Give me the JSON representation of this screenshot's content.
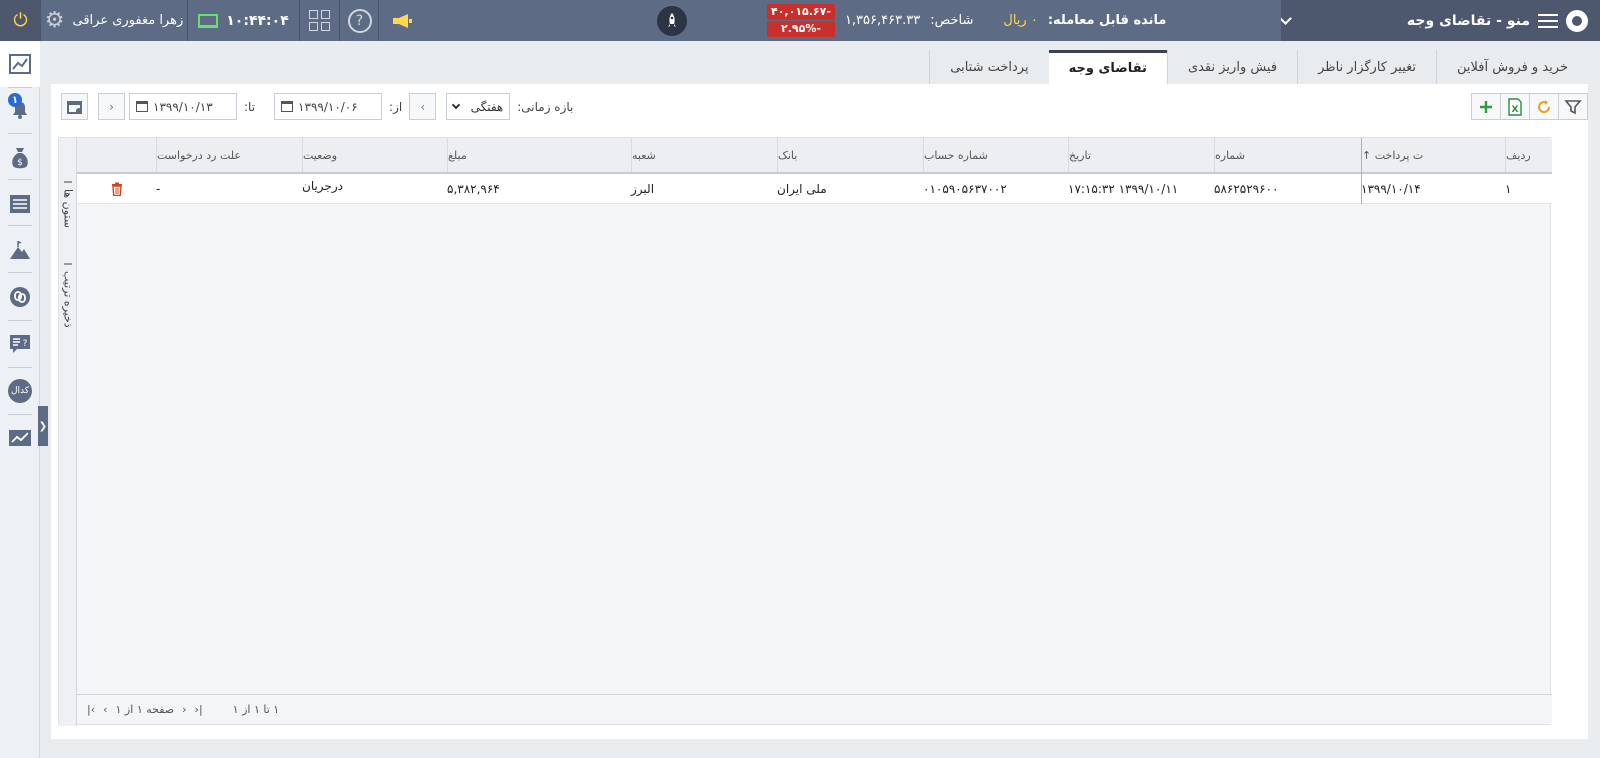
{
  "header": {
    "title": "منو - تقاضای وجه",
    "balance_label": "مانده قابل معامله:",
    "balance_value": "۰ ریال",
    "index_label": "شاخص:",
    "index_value": "۱,۳۵۶,۴۶۳.۳۳",
    "index_change": "-۴۰,۰۱۵.۶۷",
    "index_percent": "-۲.۹۵%",
    "clock": "۱۰:۴۴:۰۴",
    "user_name": "زهرا مغفوری عراقی",
    "help_glyph": "?"
  },
  "sidebar": {
    "notification_count": "۱",
    "coin_label": "کدال"
  },
  "tabs": [
    {
      "label": "پرداخت شتابی"
    },
    {
      "label": "تقاضای وجه"
    },
    {
      "label": "فیش واریز نقدی"
    },
    {
      "label": "تغییر کارگزار ناظر"
    },
    {
      "label": "خرید و فروش آفلاین"
    }
  ],
  "filters": {
    "range_label": "بازه زمانی:",
    "range_value": "هفتگی",
    "from_label": "از:",
    "from_date": "۱۳۹۹/۱۰/۰۶",
    "to_label": "تا:",
    "to_date": "۱۳۹۹/۱۰/۱۳"
  },
  "grid": {
    "columns": {
      "row": "ردیف",
      "pay_date": "ت پرداخت ↑",
      "number": "شماره",
      "date": "تاریخ",
      "account": "شماره حساب",
      "bank": "بانک",
      "branch": "شعبه",
      "amount": "مبلغ",
      "status": "وضعیت",
      "reject_reason": "علت رد درخواست"
    },
    "rows": [
      {
        "row": "۱",
        "pay_date": "۱۳۹۹/۱۰/۱۴",
        "number": "۵۸۶۲۵۲۹۶۰۰",
        "date": "۱۳۹۹/۱۰/۱۱ ۱۷:۱۵:۳۲",
        "account": "۰۱۰۵۹۰۵۶۳۷۰۰۲",
        "bank": "ملی ایران",
        "branch": "البرز",
        "amount": "۵,۳۸۲,۹۶۴",
        "status": "درجریان",
        "reject_reason": "-"
      }
    ],
    "side_labels": {
      "columns": "ستون ها",
      "save_layout": "ذخیره ترتیب"
    },
    "pager": {
      "page_text": "صفحه ۱ از ۱",
      "range_text": "۱ تا ۱ از ۱"
    }
  },
  "colors": {
    "topbar": "#5e6b84",
    "accent_yellow": "#ffd84d",
    "negative_red": "#c9302c",
    "delete_icon": "#d0451b"
  }
}
